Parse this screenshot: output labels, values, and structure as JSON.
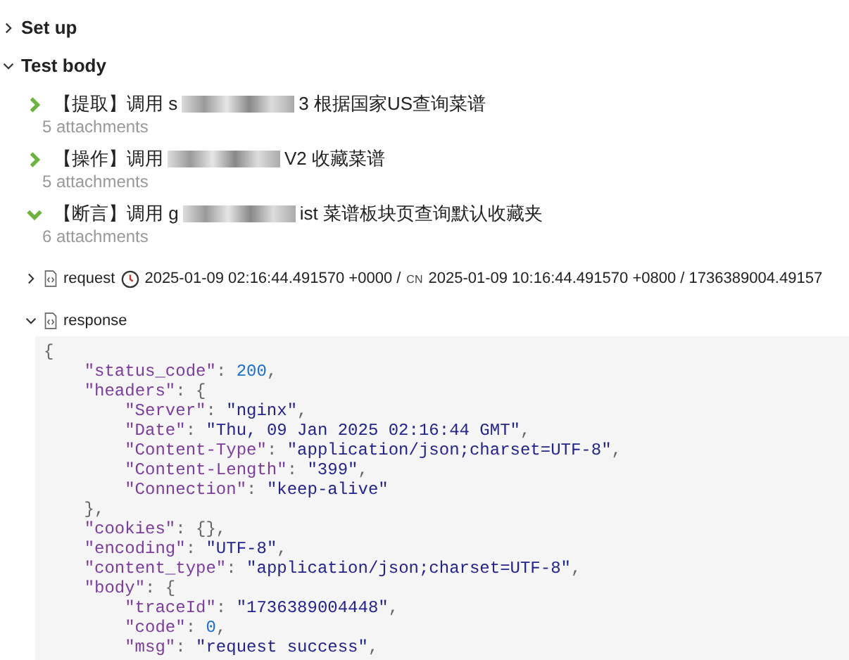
{
  "sections": [
    {
      "title": "Set up",
      "expanded": false
    },
    {
      "title": "Test body",
      "expanded": true
    }
  ],
  "steps": [
    {
      "title_start": "【提取】调用 s",
      "redacted": true,
      "title_end": "3 根据国家US查询菜谱",
      "attachments": "5 attachments",
      "expanded": false
    },
    {
      "title_start": "【操作】调用",
      "redacted": true,
      "title_end": "V2 收藏菜谱",
      "attachments": "5 attachments",
      "expanded": false
    },
    {
      "title_start": "【断言】调用 g",
      "redacted": true,
      "title_end": "ist 菜谱板块页查询默认收藏夹",
      "attachments": "6 attachments",
      "expanded": true
    }
  ],
  "attachments": [
    {
      "name": "request",
      "expanded": false,
      "time_utc": "2025-01-09 02:16:44.491570 +0000 /",
      "zone": "CN",
      "time_local": "2025-01-09 10:16:44.491570 +0800 / 1736389004.49157"
    },
    {
      "name": "response",
      "expanded": true
    }
  ],
  "code": [
    "{",
    "    \"status_code\": 200,",
    "    \"headers\": {",
    "        \"Server\": \"nginx\",",
    "        \"Date\": \"Thu, 09 Jan 2025 02:16:44 GMT\",",
    "        \"Content-Type\": \"application/json;charset=UTF-8\",",
    "        \"Content-Length\": \"399\",",
    "        \"Connection\": \"keep-alive\"",
    "    },",
    "    \"cookies\": {},",
    "    \"encoding\": \"UTF-8\",",
    "    \"content_type\": \"application/json;charset=UTF-8\",",
    "    \"body\": {",
    "        \"traceId\": \"1736389004448\",",
    "        \"code\": 0,",
    "        \"msg\": \"request success\","
  ]
}
